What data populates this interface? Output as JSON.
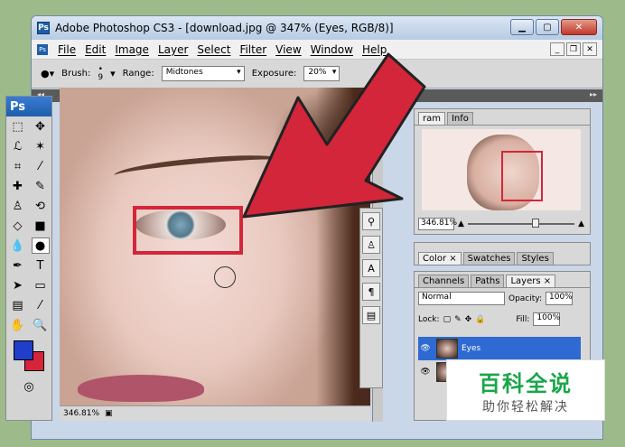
{
  "titlebar": {
    "title": "Adobe Photoshop CS3 - [download.jpg @ 347% (Eyes, RGB/8)]",
    "app_icon": "Ps"
  },
  "menubar": {
    "items": [
      "File",
      "Edit",
      "Image",
      "Layer",
      "Select",
      "Filter",
      "View",
      "Window",
      "Help"
    ]
  },
  "options": {
    "brush_label": "Brush:",
    "brush_size": "9",
    "range_label": "Range:",
    "range_value": "Midtones",
    "exposure_label": "Exposure:",
    "exposure_value": "20%"
  },
  "toolbox": {
    "header": "Ps"
  },
  "canvas": {
    "zoom_status": "346.81%"
  },
  "navigator": {
    "tabs": [
      "ram",
      "Info"
    ],
    "zoom": "346.81%"
  },
  "color_panel": {
    "tabs": [
      "Color ×",
      "Swatches",
      "Styles"
    ]
  },
  "layers_panel": {
    "tabs": [
      "Channels",
      "Paths",
      "Layers ×"
    ],
    "blend_mode": "Normal",
    "opacity_label": "Opacity:",
    "opacity_value": "100%",
    "lock_label": "Lock:",
    "fill_label": "Fill:",
    "fill_value": "100%",
    "layers": [
      "Eyes"
    ]
  },
  "watermark": {
    "title": "百科全说",
    "subtitle": "助你轻松解决"
  },
  "colors": {
    "foreground": "#1f3ec9",
    "background": "#d6253a",
    "highlight": "#d3263a",
    "arrow": "#d3263a"
  }
}
